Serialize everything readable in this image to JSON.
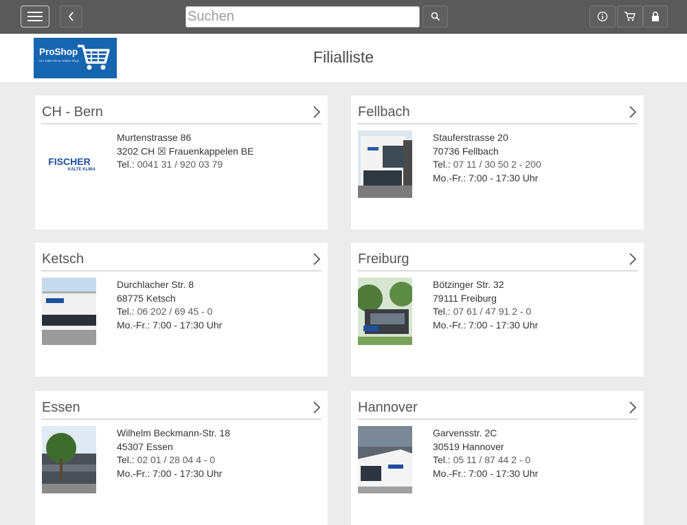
{
  "topbar": {
    "search_placeholder": "Suchen",
    "icons": {
      "menu": "hamburger-icon",
      "back": "chevron-left-icon",
      "search": "search-icon",
      "info": "info-icon",
      "cart": "cart-icon",
      "lock": "lock-icon"
    }
  },
  "header": {
    "logo_text": "ProShop",
    "logo_tagline": "Der Kälte-Klima-Online-Shop",
    "title": "Filialliste"
  },
  "colors": {
    "topbar": "#5a5a5a",
    "brand": "#1565b0",
    "background": "#ececec",
    "card": "#ffffff",
    "fischer_blue": "#1e4ea0"
  },
  "branches": [
    {
      "name": "CH - Bern",
      "image": "fischer-kaelteklima-logo",
      "logo_line1": "FISCHER",
      "logo_line2": "KÄLTE KLIMA",
      "street": "Murtenstrasse 86",
      "city": "3202 CH ☒ Frauenkappelen BE",
      "phone_label": "Tel.:",
      "phone": "0041 31 / 920 03 79",
      "hours": ""
    },
    {
      "name": "Fellbach",
      "image": "branch-building-photo",
      "street": "Stauferstrasse 20",
      "city": "70736 Fellbach",
      "phone_label": "Tel.:",
      "phone": "07 11 / 30 50 2 - 200",
      "hours": "Mo.-Fr.: 7:00 - 17:30 Uhr"
    },
    {
      "name": "Ketsch",
      "image": "branch-building-photo",
      "street": "Durchlacher Str. 8",
      "city": "68775 Ketsch",
      "phone_label": "Tel.:",
      "phone": "06 202 / 69 45 - 0",
      "hours": "Mo.-Fr.: 7:00 - 17:30 Uhr"
    },
    {
      "name": "Freiburg",
      "image": "branch-building-photo",
      "street": "Bötzinger Str. 32",
      "city": "79111 Freiburg",
      "phone_label": "Tel.:",
      "phone": "07 61 / 47 91 2 - 0",
      "hours": "Mo.-Fr.: 7:00 - 17:30 Uhr"
    },
    {
      "name": "Essen",
      "image": "branch-building-photo",
      "street": "Wilhelm Beckmann-Str. 18",
      "city": "45307 Essen",
      "phone_label": "Tel.:",
      "phone": "02 01 / 28 04 4 - 0",
      "hours": "Mo.-Fr.: 7:00 - 17:30 Uhr"
    },
    {
      "name": "Hannover",
      "image": "branch-building-photo",
      "street": "Garvensstr. 2C",
      "city": "30519 Hannover",
      "phone_label": "Tel.:",
      "phone": "05 11 / 87 44 2 - 0",
      "hours": "Mo.-Fr.: 7:00 - 17:30 Uhr"
    }
  ]
}
